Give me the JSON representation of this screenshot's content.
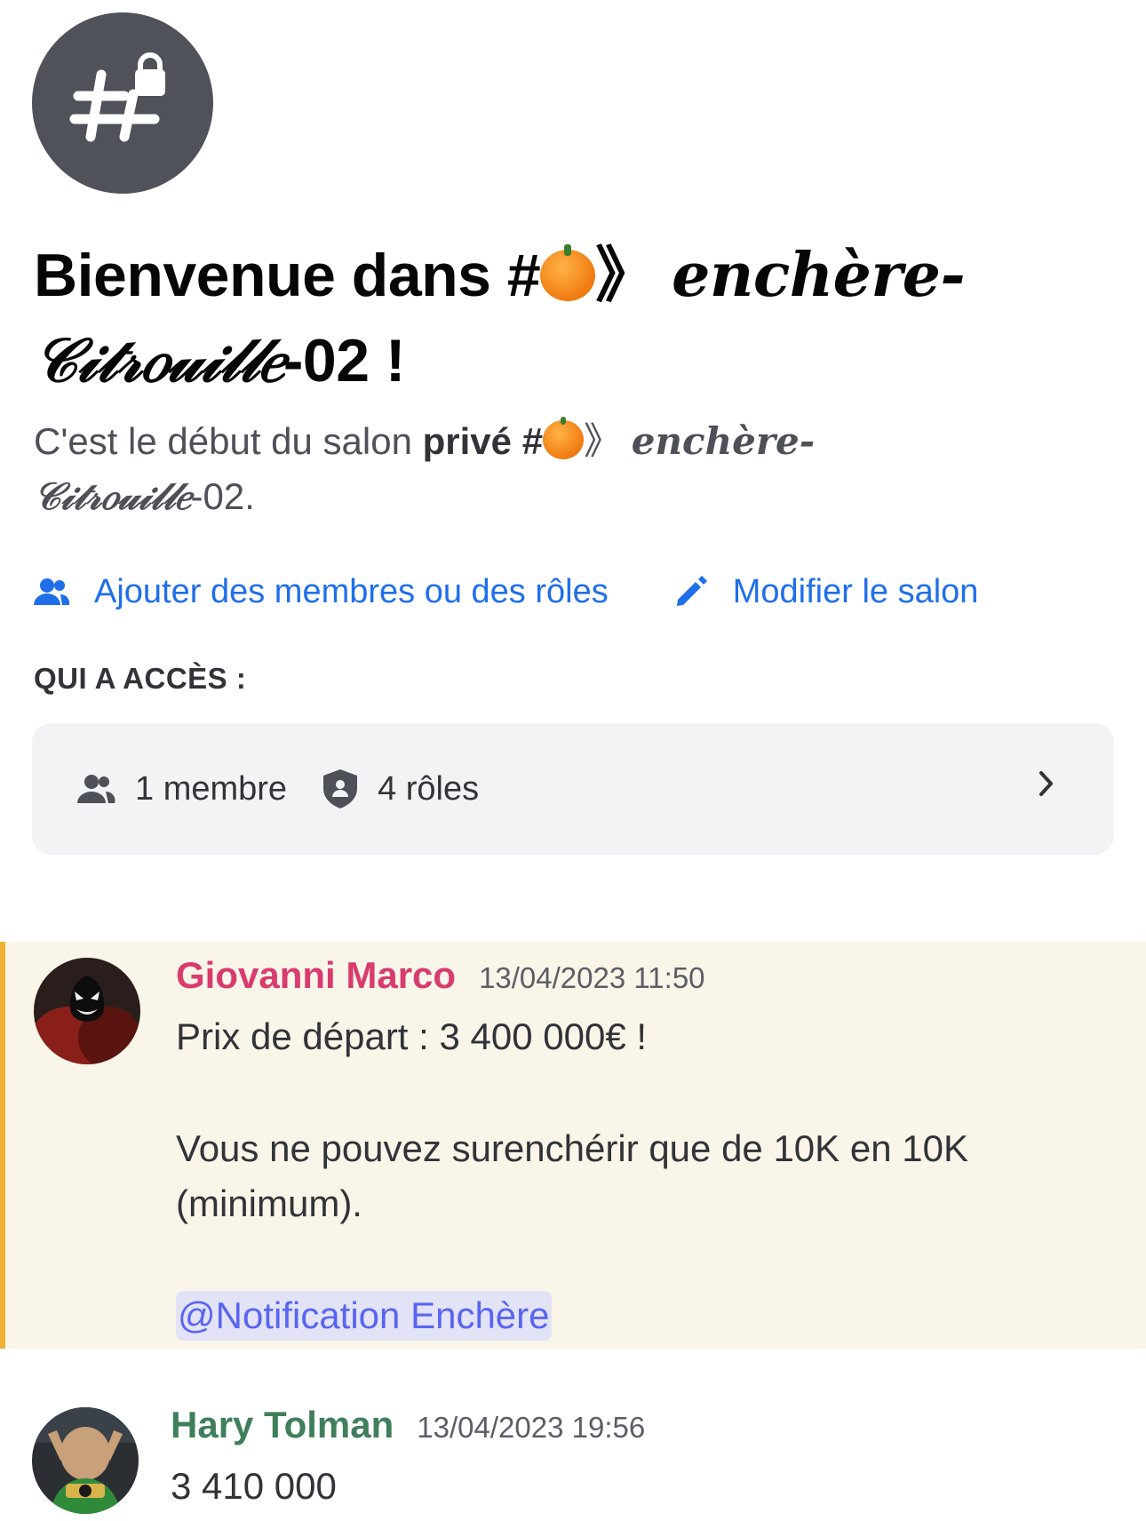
{
  "channel": {
    "icon": "private-channel-hash-lock-icon",
    "welcome_prefix": "Bienvenue dans #",
    "name_arrow": "》",
    "name_fancy_1": "𝒆𝒏𝒄𝒉è𝒓𝒆-",
    "name_fancy_2": "𝒞𝒾𝓉𝓇𝑜𝓊𝒾𝓁𝓁𝑒",
    "name_suffix": "-02 !",
    "sub_prefix": "C'est le début du salon ",
    "sub_private": "privé",
    "sub_hash": " #",
    "sub_name_suffix": "-02."
  },
  "actions": {
    "add_members_label": "Ajouter des membres ou des rôles",
    "edit_channel_label": "Modifier le salon"
  },
  "access": {
    "heading": "QUI A ACCÈS :",
    "members_label": "1 membre",
    "roles_label": "4 rôles"
  },
  "messages": [
    {
      "author": "Giovanni Marco",
      "author_color": "#d83c6e",
      "timestamp": "13/04/2023 11:50",
      "lines": [
        "Prix de départ : 3 400 000€ !",
        "Vous ne pouvez surenchérir que de 10K en 10K (minimum)."
      ],
      "mention": "@Notification Enchère"
    },
    {
      "author": "Hary Tolman",
      "author_color": "#3f7f5c",
      "timestamp": "13/04/2023 19:56",
      "lines": [
        "3 410 000"
      ]
    }
  ],
  "colors": {
    "link_blue": "#1f6feb",
    "highlight_bg": "#faf5e9",
    "highlight_bar": "#f0b232",
    "mention_bg": "#e3e3f7",
    "mention_text": "#5865f2"
  }
}
